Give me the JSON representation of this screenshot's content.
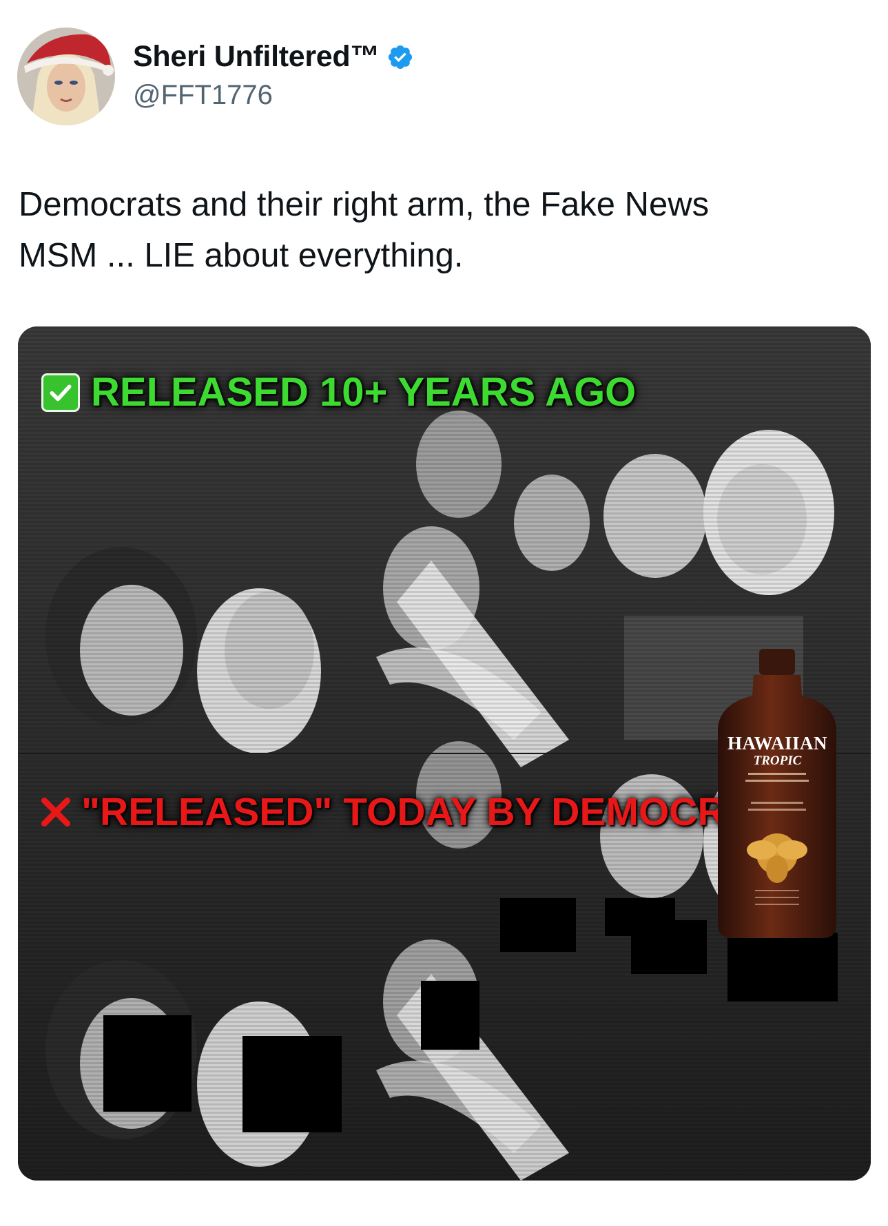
{
  "tweet": {
    "author": {
      "display_name": "Sheri Unfiltered™",
      "handle": "@FFT1776",
      "verified": true,
      "verified_color": "#1d9bf0"
    },
    "text_lines": [
      "Democrats and their right arm, the Fake News",
      "MSM ... LIE about everything."
    ]
  },
  "media": {
    "top_caption": "RELEASED 10+ YEARS AGO",
    "top_caption_icon": "green-check-icon",
    "top_caption_color": "#3ddb31",
    "bottom_caption": "\"RELEASED\" TODAY BY DEMOCRATS",
    "bottom_caption_icon": "red-x-icon",
    "bottom_caption_color": "#e81818",
    "bottle": {
      "brand": "HAWAIIAN",
      "brand_sub": "TROPIC"
    }
  }
}
